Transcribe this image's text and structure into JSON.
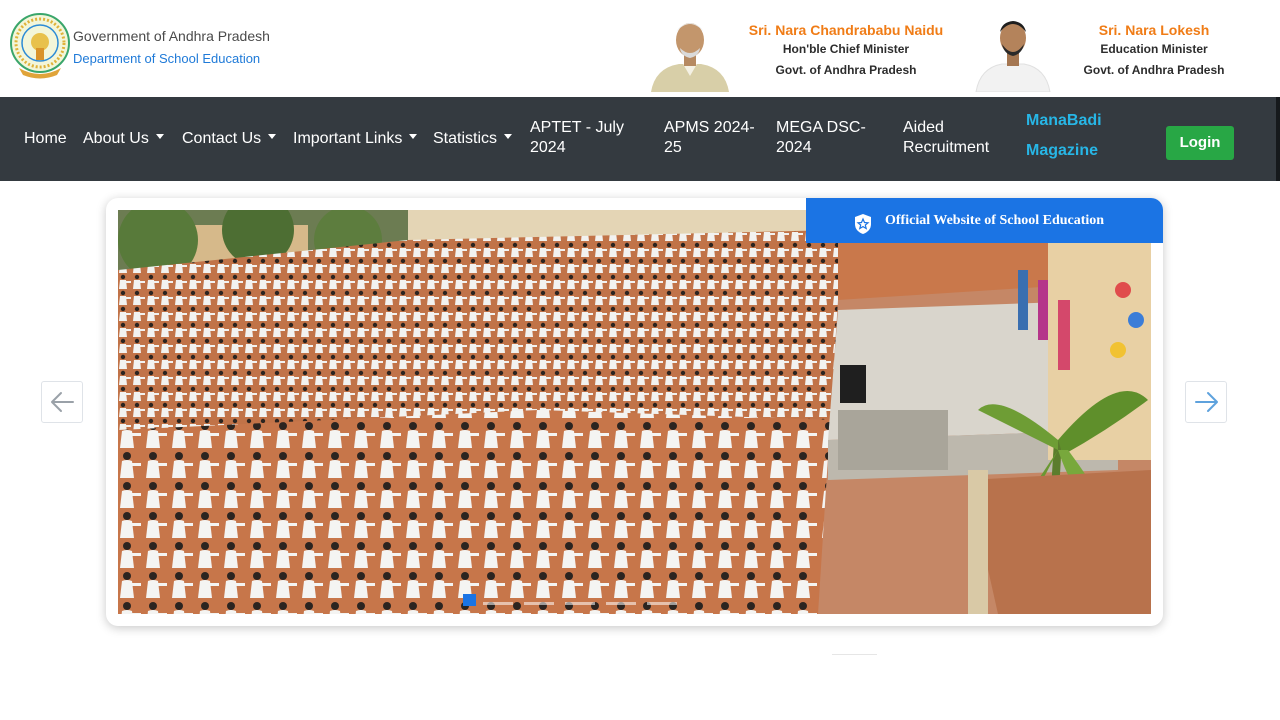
{
  "header": {
    "gov_name": "Government of Andhra Pradesh",
    "dept_name": "Department of School Education",
    "emblem_icon": "ap-state-emblem-icon",
    "cm": {
      "name": "Sri. Nara Chandrababu Naidu",
      "role": "Hon'ble Chief Minister",
      "govt": "Govt. of Andhra Pradesh"
    },
    "edu_minister": {
      "name": "Sri. Nara Lokesh",
      "role": "Education Minister",
      "govt": "Govt. of Andhra Pradesh"
    }
  },
  "nav": {
    "home": "Home",
    "about": "About Us",
    "contact": "Contact Us",
    "links": "Important Links",
    "statistics": "Statistics",
    "aptet": "APTET - July 2024",
    "apms": "APMS 2024-25",
    "dsc": "MEGA DSC-2024",
    "aided": "Aided Recruitment",
    "manabadi": "ManaBadi Magazine",
    "login": "Login"
  },
  "carousel": {
    "banner": "Official Website of School Education",
    "slide_icon": "school-assembly-photo",
    "active_index": 0,
    "slide_count": 6,
    "prev_icon": "arrow-left-icon",
    "next_icon": "arrow-right-icon"
  },
  "colors": {
    "navbar": "#343a40",
    "accent_blue": "#1b74e4",
    "leader_orange": "#f07c16",
    "login_green": "#28a745",
    "magazine_cyan": "#27b6e6"
  }
}
